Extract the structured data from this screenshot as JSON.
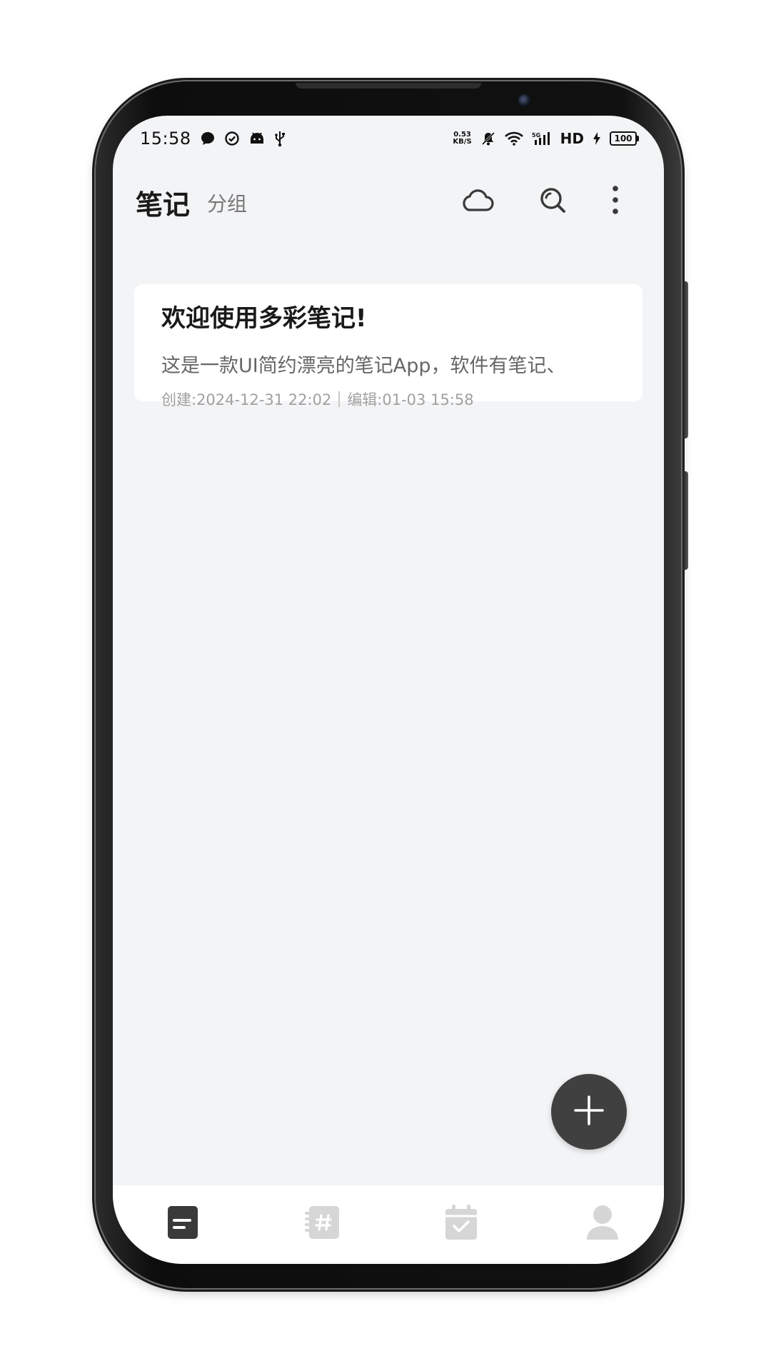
{
  "status_bar": {
    "time": "15:58",
    "net_rate_value": "0.53",
    "net_rate_unit": "KB/S",
    "hd": "HD",
    "battery": "100"
  },
  "header": {
    "tab_notes": "笔记",
    "tab_groups": "分组"
  },
  "notes": [
    {
      "title": "欢迎使用多彩笔记!",
      "preview": "这是一款UI简约漂亮的笔记App，软件有笔记、",
      "created": "创建:2024-12-31 22:02",
      "edited": "编辑:01-03 15:58"
    }
  ],
  "colors": {
    "background": "#f3f4f6",
    "card": "#ffffff",
    "fab": "#404040",
    "nav_active": "#3a3a3a",
    "nav_inactive": "#d6d6d6"
  },
  "icons": {
    "header": [
      "cloud-icon",
      "search-icon",
      "more-vertical-icon"
    ],
    "fab": "plus-icon",
    "nav": [
      "notes-icon",
      "tag-notebook-icon",
      "calendar-check-icon",
      "user-icon"
    ]
  }
}
